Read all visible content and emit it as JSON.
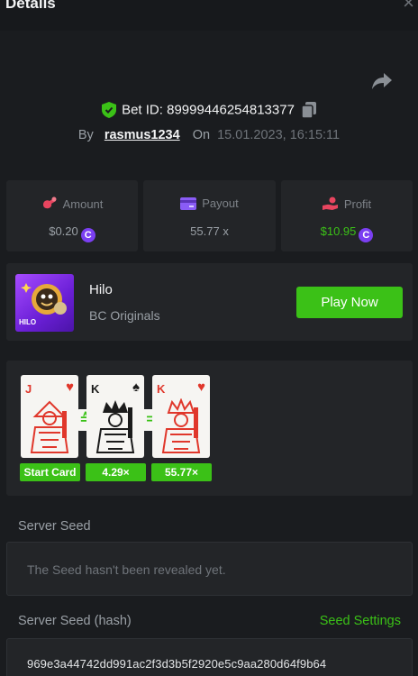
{
  "header": {
    "title": "Details",
    "close_symbol": "×"
  },
  "bet": {
    "id_label": "Bet ID: 89999446254813377",
    "by_label": "By",
    "username": "rasmus1234",
    "on_label": "On",
    "datetime": "15.01.2023, 16:15:11"
  },
  "stats": {
    "amount": {
      "label": "Amount",
      "value": "$0.20",
      "icon": "amount-icon"
    },
    "payout": {
      "label": "Payout",
      "value": "55.77 x",
      "icon": "card-icon"
    },
    "profit": {
      "label": "Profit",
      "value": "$10.95",
      "icon": "profit-icon"
    }
  },
  "game": {
    "name": "Hilo",
    "provider": "BC Originals",
    "thumb_text": "HILO",
    "play_label": "Play Now"
  },
  "cards": [
    {
      "rank": "J",
      "suit": "♥",
      "color": "#e0372b",
      "tag": "Start Card"
    },
    {
      "rank": "K",
      "suit": "♠",
      "color": "#1b1b1b",
      "tag": "4.29×"
    },
    {
      "rank": "K",
      "suit": "♥",
      "color": "#e0372b",
      "tag": "55.77×"
    }
  ],
  "ops": [
    "≙",
    "="
  ],
  "seeds": {
    "server_seed_label": "Server Seed",
    "server_seed_message": "The Seed hasn't been revealed yet.",
    "hash_label": "Server Seed (hash)",
    "settings_label": "Seed Settings",
    "hash_value": "969e3a44742dd991ac2f3d3b5f2920e5c9aa280d64f9b64"
  },
  "colors": {
    "accent_green": "#3bc117",
    "coin_purple": "#7b3ff2",
    "background": "#1a1c1f",
    "panel": "#232528"
  }
}
